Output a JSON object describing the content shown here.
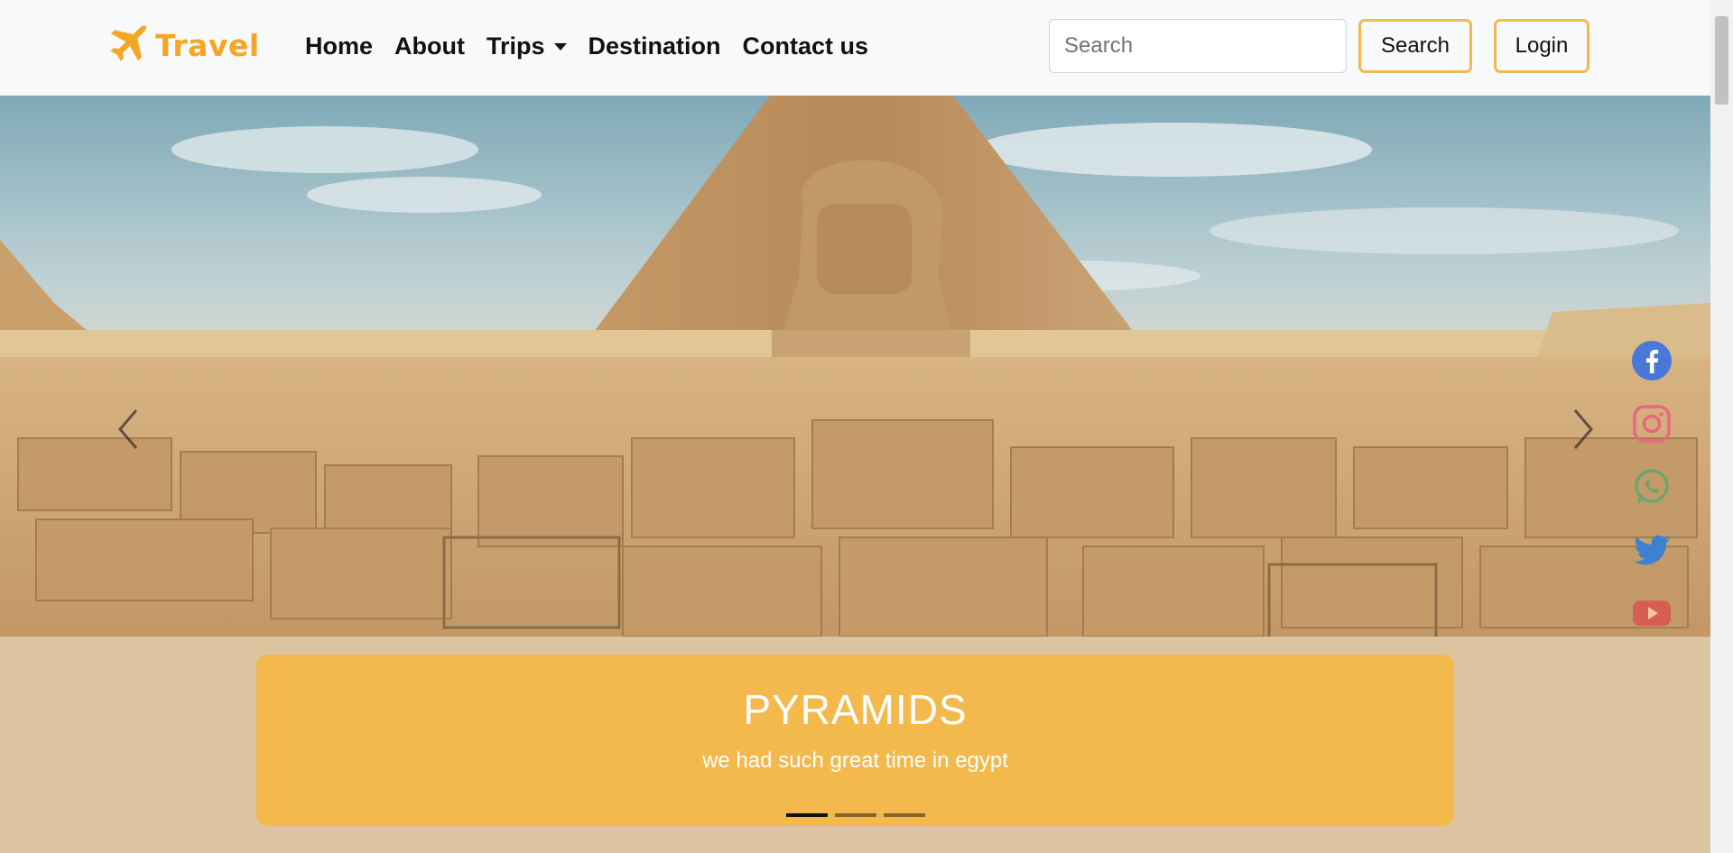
{
  "brand": {
    "name": "Travel",
    "icon": "airplane-icon",
    "color": "#f5a623"
  },
  "nav": {
    "links": [
      {
        "label": "Home"
      },
      {
        "label": "About"
      },
      {
        "label": "Trips",
        "dropdown": true
      },
      {
        "label": "Destination"
      },
      {
        "label": "Contact us"
      }
    ]
  },
  "search": {
    "placeholder": "Search",
    "button_label": "Search"
  },
  "auth": {
    "login_label": "Login"
  },
  "accent_color": "#f3b94d",
  "carousel": {
    "slide_count": 3,
    "active_index": 0,
    "caption": {
      "title": "PYRAMIDS",
      "text": "we had such great time in egypt"
    },
    "prev_icon": "chevron-left-icon",
    "next_icon": "chevron-right-icon"
  },
  "social": [
    {
      "name": "facebook-icon",
      "color": "#3b5998"
    },
    {
      "name": "instagram-icon",
      "color": "#e1306c"
    },
    {
      "name": "whatsapp-icon",
      "color": "#25d366"
    },
    {
      "name": "twitter-icon",
      "color": "#1da1f2"
    },
    {
      "name": "youtube-icon",
      "color": "#ff0000"
    }
  ]
}
